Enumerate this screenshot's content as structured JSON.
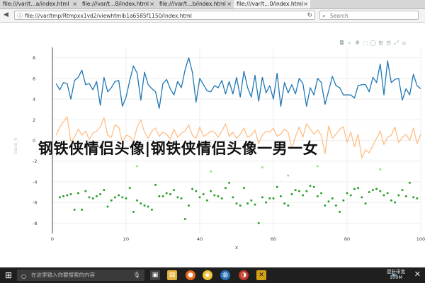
{
  "tabs": [
    {
      "label": "file:///var/t…a/index.html",
      "active": false
    },
    {
      "label": "file:///var/t…8/index.html",
      "active": false
    },
    {
      "label": "file:///var/t…b/index.html",
      "active": false
    },
    {
      "label": "file:///var/t…0/index.html",
      "active": true
    }
  ],
  "address": {
    "url": "file:///var/tmp/Rtmpxx1vd2/viewhtmlb1a6585f1150/index.html"
  },
  "search": {
    "placeholder": "Search"
  },
  "overlay_text": "钢铁侠情侣头像|钢铁侠情侣头像一男一女",
  "modebar_icons": [
    "camera-icon",
    "zoom-icon",
    "pan-icon",
    "box-select-icon",
    "lasso-icon",
    "zoom-in-icon",
    "zoom-out-icon",
    "autoscale-icon",
    "reset-icon"
  ],
  "taskbar": {
    "search_placeholder": "在这里输入你要搜索的内容",
    "tray_line1": "提升带宽",
    "tray_line2": "100M",
    "apps": [
      "start-icon",
      "search-icon",
      "task-view-icon",
      "file-explorer-icon",
      "firefox-icon",
      "chrome-icon",
      "app-icon",
      "app-icon",
      "terminal-icon"
    ]
  },
  "chart_data": {
    "type": "scatter",
    "xlabel": "x",
    "ylabel": "trace_0",
    "xlim": [
      0,
      100
    ],
    "ylim": [
      -9,
      9
    ],
    "xticks": [
      0,
      20,
      40,
      60,
      80,
      100
    ],
    "yticks": [
      -8,
      -6,
      -4,
      -2,
      0,
      2,
      4,
      6,
      8
    ],
    "colors": {
      "blue": "#1f77b4",
      "orange": "#ffbe85",
      "green": "#2ca02c",
      "lightgreen": "#98df8a"
    },
    "series": [
      {
        "mode": "lines",
        "color": "blue",
        "x": [
          1,
          2,
          3,
          4,
          5,
          6,
          7,
          8,
          9,
          10,
          11,
          12,
          13,
          14,
          15,
          16,
          17,
          18,
          19,
          20,
          21,
          22,
          23,
          24,
          25,
          26,
          27,
          28,
          29,
          30,
          31,
          32,
          33,
          34,
          35,
          36,
          37,
          38,
          39,
          40,
          41,
          42,
          43,
          44,
          45,
          46,
          47,
          48,
          49,
          50,
          51,
          52,
          53,
          54,
          55,
          56,
          57,
          58,
          59,
          60,
          61,
          62,
          63,
          64,
          65,
          66,
          67,
          68,
          69,
          70,
          71,
          72,
          73,
          74,
          75,
          76,
          77,
          78,
          79,
          80,
          81,
          82,
          83,
          84,
          85,
          86,
          87,
          88,
          89,
          90,
          91,
          92,
          93,
          94,
          95,
          96,
          97,
          98,
          99,
          100
        ],
        "y": [
          5.5,
          4.9,
          5.6,
          5.5,
          4.0,
          5.8,
          6.1,
          6.8,
          5.4,
          5.5,
          4.9,
          5.7,
          3.4,
          6.1,
          4.7,
          5.1,
          5.7,
          5.8,
          3.3,
          4.2,
          5.8,
          7.2,
          6.5,
          3.9,
          6.6,
          5.4,
          5.0,
          4.7,
          3.1,
          5.5,
          5.9,
          5.0,
          4.4,
          5.7,
          5.1,
          6.8,
          8.0,
          6.6,
          3.7,
          6.0,
          5.4,
          4.8,
          4.7,
          5.3,
          5.1,
          5.8,
          4.5,
          5.7,
          4.5,
          6.1,
          4.2,
          6.7,
          5.1,
          4.2,
          6.3,
          3.8,
          6.1,
          4.6,
          5.3,
          4.0,
          6.5,
          3.3,
          5.6,
          4.6,
          5.4,
          4.5,
          6.0,
          5.5,
          3.3,
          5.1,
          4.4,
          6.0,
          5.6,
          3.5,
          4.8,
          6.2,
          5.3,
          5.1,
          4.4,
          4.4,
          4.4,
          4.1,
          5.3,
          5.4,
          5.4,
          4.7,
          6.1,
          5.6,
          7.4,
          4.4,
          7.7,
          5.6,
          5.9,
          6.0,
          3.9,
          5.0,
          4.4,
          6.4,
          5.3,
          5.0
        ]
      },
      {
        "mode": "lines",
        "color": "orange",
        "x": [
          1,
          2,
          3,
          4,
          5,
          6,
          7,
          8,
          9,
          10,
          11,
          12,
          13,
          14,
          15,
          16,
          17,
          18,
          19,
          20,
          21,
          22,
          23,
          24,
          25,
          26,
          27,
          28,
          29,
          30,
          31,
          32,
          33,
          34,
          35,
          36,
          37,
          38,
          39,
          40,
          41,
          42,
          43,
          44,
          45,
          46,
          47,
          48,
          49,
          50,
          51,
          52,
          53,
          54,
          55,
          56,
          57,
          58,
          59,
          60,
          61,
          62,
          63,
          64,
          65,
          66,
          67,
          68,
          69,
          70,
          71,
          72,
          73,
          74,
          75,
          76,
          77,
          78,
          79,
          80,
          81,
          82,
          83,
          84,
          85,
          86,
          87,
          88,
          89,
          90,
          91,
          92,
          93,
          94,
          95,
          96,
          97,
          98,
          99,
          100
        ],
        "y": [
          0.5,
          1.3,
          1.8,
          2.3,
          -0.1,
          0.3,
          1.1,
          0.5,
          0.9,
          0.1,
          0.7,
          0.9,
          1.3,
          2.2,
          0.5,
          0.3,
          1.5,
          1.3,
          -0.2,
          0.5,
          0.4,
          -0.1,
          1.3,
          2.0,
          0.8,
          0.2,
          0.9,
          1.2,
          0.4,
          0.8,
          0.6,
          0.1,
          1.1,
          0.3,
          0.7,
          0.9,
          1.5,
          0.5,
          0.2,
          1.3,
          0.4,
          0.6,
          0.9,
          0.8,
          0.3,
          0.9,
          1.6,
          0.4,
          0.8,
          0.2,
          0.6,
          1.2,
          0.3,
          0.5,
          1.0,
          -0.3,
          0.5,
          0.9,
          0.8,
          1.2,
          0.4,
          0.6,
          1.1,
          0.8,
          -0.8,
          0.4,
          1.3,
          0.3,
          1.6,
          1.1,
          0.6,
          1.0,
          0.5,
          -1.3,
          1.4,
          0.2,
          0.6,
          1.1,
          1.3,
          -0.2,
          0.8,
          -0.6,
          0.6,
          -1.7,
          -0.9,
          -1.2,
          -0.5,
          0.2,
          0.9,
          -0.4,
          0.3,
          0.5,
          1.3,
          -0.2,
          0.3,
          0.6,
          0.0,
          1.2,
          -0.3,
          0.6
        ]
      },
      {
        "mode": "markers",
        "color": "green",
        "x": [
          2,
          3,
          4,
          5,
          6,
          7,
          8,
          9,
          10,
          11,
          12,
          13,
          14,
          15,
          16,
          17,
          18,
          19,
          20,
          21,
          22,
          23,
          24,
          25,
          26,
          27,
          28,
          29,
          30,
          31,
          32,
          33,
          34,
          35,
          36,
          37,
          38,
          39,
          40,
          41,
          42,
          43,
          44,
          45,
          46,
          47,
          48,
          49,
          50,
          51,
          52,
          53,
          54,
          55,
          56,
          57,
          58,
          59,
          60,
          61,
          62,
          63,
          64,
          65,
          66,
          67,
          68,
          69,
          70,
          71,
          72,
          73,
          74,
          75,
          76,
          77,
          78,
          79,
          80,
          81,
          82,
          83,
          84,
          85,
          86,
          87,
          88,
          89,
          90,
          91,
          92,
          93,
          94,
          95,
          96,
          97,
          98,
          99
        ],
        "y": [
          -5.5,
          -5.4,
          -5.3,
          -5.2,
          -6.7,
          -5.1,
          -6.7,
          -4.9,
          -5.5,
          -5.6,
          -5.4,
          -5.2,
          -4.8,
          -6.4,
          -5.8,
          -5.5,
          -5.3,
          -5.5,
          -5.6,
          -4.6,
          -6.9,
          -5.8,
          -6.1,
          -6.3,
          -6.4,
          -6.7,
          -4.3,
          -5.4,
          -5.4,
          -5.1,
          -5.2,
          -4.8,
          -5.5,
          -5.6,
          -7.6,
          -6.3,
          -4.7,
          -4.9,
          -5.5,
          -5.2,
          -5.8,
          -4.9,
          -5.3,
          -5.4,
          -5.6,
          -4.6,
          -4.1,
          -5.5,
          -6.1,
          -6.3,
          -4.6,
          -6.1,
          -5.8,
          -6.2,
          -8.0,
          -5.5,
          -6.0,
          -5.6,
          -5.6,
          -4.5,
          -5.4,
          -6.1,
          -6.3,
          -5.2,
          -4.8,
          -4.9,
          -5.3,
          -4.9,
          -4.4,
          -4.5,
          -5.4,
          -5.1,
          -6.3,
          -5.9,
          -5.6,
          -6.3,
          -6.9,
          -5.8,
          -5.1,
          -5.3,
          -4.7,
          -4.6,
          -5.5,
          -6.1,
          -5.0,
          -4.8,
          -4.7,
          -4.9,
          -5.3,
          -5.1,
          -5.8,
          -6.0,
          -5.3,
          -4.8,
          -5.4,
          -4.1,
          -5.5,
          -5.6
        ]
      },
      {
        "mode": "markers",
        "color": "lightgreen",
        "x": [
          23,
          43,
          57,
          64,
          72,
          89
        ],
        "y": [
          -2.5,
          -3.0,
          -2.6,
          -3.4,
          -2.5,
          -2.8
        ]
      }
    ]
  }
}
